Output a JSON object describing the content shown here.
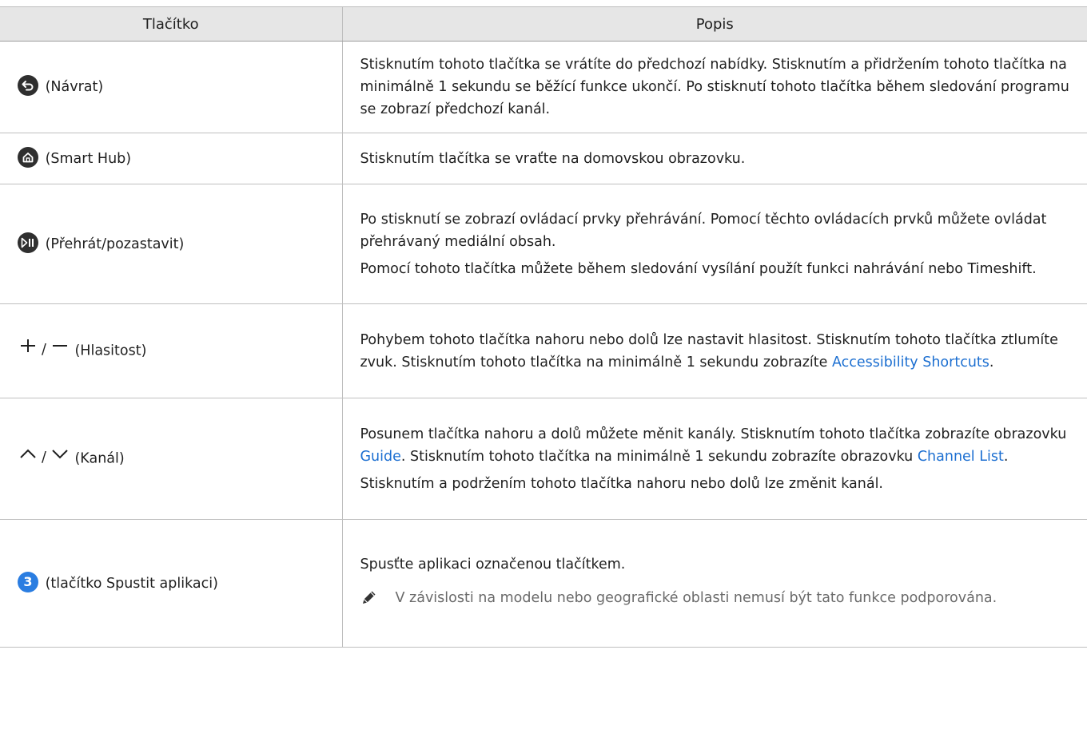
{
  "header": {
    "col_button": "Tlačítko",
    "col_description": "Popis"
  },
  "rows": [
    {
      "icon": "return-icon",
      "label": "(Návrat)",
      "description": [
        "Stisknutím tohoto tlačítka se vrátíte do předchozí nabídky. Stisknutím a přidržením tohoto tlačítka na minimálně 1 sekundu se běžící funkce ukončí. Po stisknutí tohoto tlačítka během sledování programu se zobrazí předchozí kanál."
      ]
    },
    {
      "icon": "home-icon",
      "label": "(Smart Hub)",
      "description": [
        "Stisknutím tlačítka se vraťte na domovskou obrazovku."
      ]
    },
    {
      "icon": "play-pause-icon",
      "label": "(Přehrát/pozastavit)",
      "description": [
        "Po stisknutí se zobrazí ovládací prvky přehrávání. Pomocí těchto ovládacích prvků můžete ovládat přehrávaný mediální obsah.",
        "Pomocí tohoto tlačítka můžete během sledování vysílání použít funkci nahrávání nebo Timeshift."
      ]
    },
    {
      "icon": "plus-minus-icon",
      "label": "(Hlasitost)",
      "desc_before": "Pohybem tohoto tlačítka nahoru nebo dolů lze nastavit hlasitost. Stisknutím tohoto tlačítka ztlumíte zvuk. Stisknutím tohoto tlačítka na minimálně 1 sekundu zobrazíte ",
      "link": "Accessibility Shortcuts",
      "desc_after": "."
    },
    {
      "icon": "chevron-up-down-icon",
      "label": "(Kanál)",
      "desc_a": "Posunem tlačítka nahoru a dolů můžete měnit kanály. Stisknutím tohoto tlačítka zobrazíte obrazovku ",
      "link1": "Guide",
      "desc_b": ". Stisknutím tohoto tlačítka na minimálně 1 sekundu zobrazíte obrazovku ",
      "link2": "Channel List",
      "desc_c": ".",
      "desc2": "Stisknutím a podržením tohoto tlačítka nahoru nebo dolů lze změnit kanál."
    },
    {
      "icon": "number-3-icon",
      "icon_text": "3",
      "label": "(tlačítko Spustit aplikaci)",
      "description": [
        "Spusťte aplikaci označenou tlačítkem."
      ],
      "note": "V závislosti na modelu nebo geografické oblasti nemusí být tato funkce podporována."
    }
  ],
  "separator": "/",
  "colors": {
    "link": "#1c6fd1",
    "header_bg": "#e6e6e6",
    "icon_dark": "#2f2f2f",
    "icon_blue": "#2a7de1",
    "note_text": "#6a6a6a"
  }
}
